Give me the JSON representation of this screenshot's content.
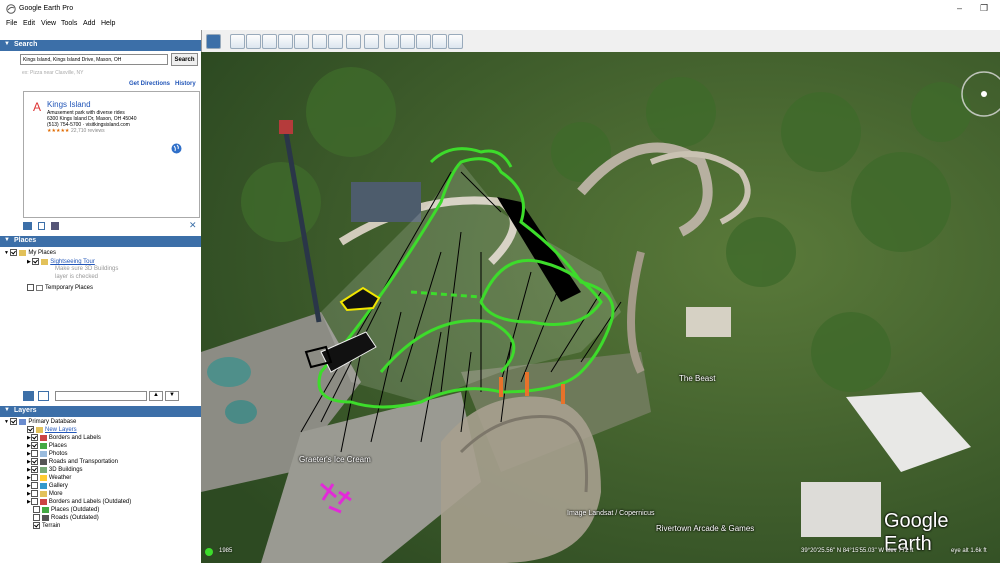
{
  "window": {
    "title": "Google Earth Pro",
    "minimize": "–",
    "restore": "❐"
  },
  "menu": [
    "File",
    "Edit",
    "View",
    "Tools",
    "Add",
    "Help"
  ],
  "search": {
    "header": "Search",
    "value": "Kings Island, Kings Island Drive, Mason, OH",
    "button": "Search",
    "hint": "ex: Pizza near Claxville, NY",
    "get_directions": "Get Directions",
    "history": "History"
  },
  "result": {
    "marker": "A",
    "name": "Kings Island",
    "description": "Amusement park with diverse rides",
    "address": "6300 Kings Island Dr, Mason, OH 45040",
    "contact": "(513) 754-5700 · visitkingsisland.com",
    "stars": "★★★★★",
    "reviews": "22,710 reviews"
  },
  "places": {
    "header": "Places",
    "my_places": "My Places",
    "sightseeing": "Sightseeing Tour",
    "note_line1": "Make sure 3D Buildings",
    "note_line2": "layer is checked",
    "temporary": "Temporary Places"
  },
  "layers": {
    "header": "Layers",
    "items": [
      {
        "label": "Primary Database",
        "checked": true,
        "link": false
      },
      {
        "label": "New Layers",
        "checked": true,
        "link": true
      },
      {
        "label": "Borders and Labels",
        "checked": true,
        "link": false
      },
      {
        "label": "Places",
        "checked": true,
        "link": false
      },
      {
        "label": "Photos",
        "checked": false,
        "link": false
      },
      {
        "label": "Roads and Transportation",
        "checked": true,
        "link": false
      },
      {
        "label": "3D Buildings",
        "checked": true,
        "link": false
      },
      {
        "label": "Weather",
        "checked": false,
        "link": false
      },
      {
        "label": "Gallery",
        "checked": false,
        "link": false
      },
      {
        "label": "More",
        "checked": false,
        "link": false
      },
      {
        "label": "Borders and Labels (Outdated)",
        "checked": false,
        "link": false
      },
      {
        "label": "Places (Outdated)",
        "checked": false,
        "link": false
      },
      {
        "label": "Roads (Outdated)",
        "checked": false,
        "link": false
      },
      {
        "label": "Terrain",
        "checked": true,
        "link": false
      }
    ]
  },
  "map": {
    "labels": {
      "beast": "The Beast",
      "icecream": "Graeter's Ice Cream",
      "arcade": "Rivertown Arcade & Games",
      "credit": "Image Landsat / Copernicus",
      "logo": "Google Earth"
    },
    "status": {
      "year": "1985",
      "coords": "39°20'25.56\" N   84°15'55.03\" W   elev   772 ft",
      "eye": "eye alt   1.6k ft"
    }
  },
  "colors": {
    "accent": "#3c6fa8",
    "link": "#2256b8",
    "drawing": "#3ddc2b",
    "marker": "#d33"
  }
}
